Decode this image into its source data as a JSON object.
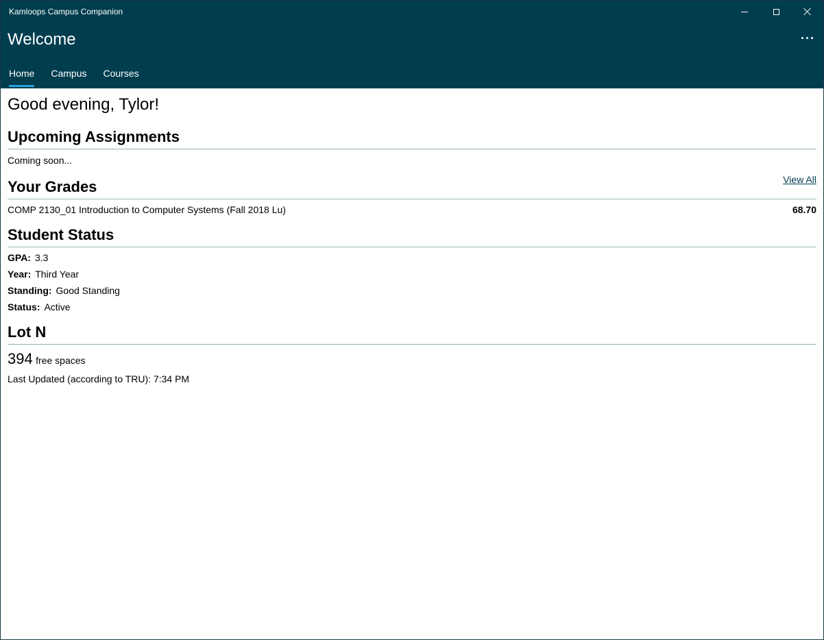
{
  "window": {
    "app_title": "Kamloops Campus Companion"
  },
  "header": {
    "title": "Welcome",
    "more_icon": "ellipsis-icon"
  },
  "tabs": [
    {
      "label": "Home",
      "active": true
    },
    {
      "label": "Campus",
      "active": false
    },
    {
      "label": "Courses",
      "active": false
    }
  ],
  "greeting": "Good evening, Tylor!",
  "assignments": {
    "title": "Upcoming Assignments",
    "body": "Coming soon..."
  },
  "grades": {
    "title": "Your Grades",
    "view_all": "View All",
    "rows": [
      {
        "course": "COMP 2130_01 Introduction to Computer Systems (Fall 2018 Lu)",
        "grade": "68.70"
      }
    ]
  },
  "status": {
    "title": "Student Status",
    "items": [
      {
        "label": "GPA:",
        "value": "3.3"
      },
      {
        "label": "Year:",
        "value": "Third Year"
      },
      {
        "label": "Standing:",
        "value": "Good Standing"
      },
      {
        "label": "Status:",
        "value": "Active"
      }
    ]
  },
  "lot": {
    "title": "Lot N",
    "count": "394",
    "count_suffix": "free spaces",
    "updated": "Last Updated (according to TRU): 7:34 PM"
  },
  "colors": {
    "chrome": "#003e4f",
    "accent": "#2b9fdd",
    "divider": "#9ab4bc"
  }
}
